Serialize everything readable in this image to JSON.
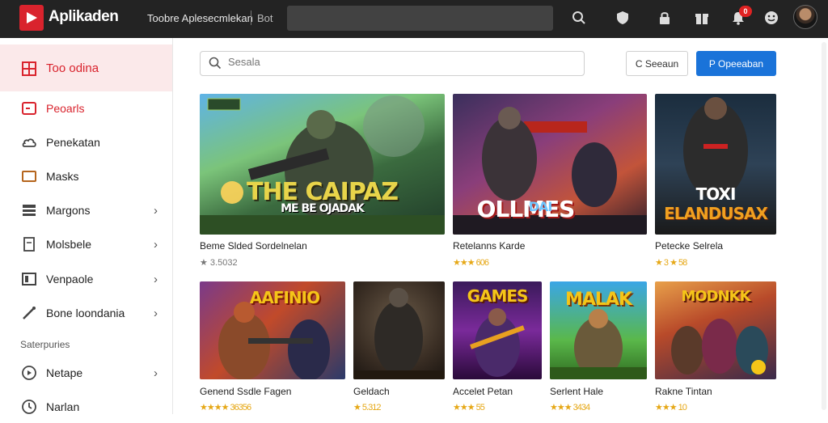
{
  "app": {
    "title": "Aplikaden"
  },
  "topbar": {
    "link": "Toobre Aplesecmlekan",
    "link2": "Bot"
  },
  "sidebar": {
    "items": [
      {
        "label": "Too odina",
        "icon": "grid-icon"
      },
      {
        "label": "Peoarls",
        "icon": "folder-icon"
      },
      {
        "label": "Penekatan",
        "icon": "cloud-icon"
      },
      {
        "label": "Masks",
        "icon": "box-icon"
      },
      {
        "label": "Margons",
        "icon": "layers-icon"
      },
      {
        "label": "Molsbele",
        "icon": "file-icon"
      },
      {
        "label": "Venpaole",
        "icon": "window-icon"
      },
      {
        "label": "Bone loondania",
        "icon": "brush-icon"
      }
    ],
    "section_label": "Saterpuries",
    "section_items": [
      {
        "label": "Netape",
        "icon": "compass-icon"
      },
      {
        "label": "Narlan",
        "icon": "clock-icon"
      }
    ]
  },
  "main": {
    "search_placeholder": "Sesala",
    "ghost_button": "C Seeaun",
    "primary_button": "P Opeeaban"
  },
  "games_row1": [
    {
      "title": "Beme Slded Sordelnelan",
      "rating": "★ 3.5032",
      "art_text": "THE CAIPAZ",
      "art_sub": "ME BE OJADAK"
    },
    {
      "title": "Retelanns Karde",
      "rating": "★★★ 606",
      "art_text": "OLLMES",
      "art_sub": "DAI"
    },
    {
      "title": "Petecke Selrela",
      "rating": "★ 3 ★ 58",
      "art_text": "TOXI",
      "art_sub": "ELANDUSAX"
    }
  ],
  "games_row2": [
    {
      "title": "Genend Ssdle Fagen",
      "rating": "★★★★ 36356",
      "art_text": "AAFINIO"
    },
    {
      "title": "Geldach",
      "rating": "★ 5.312",
      "art_text": ""
    },
    {
      "title": "Accelet Petan",
      "rating": "★★★ 55",
      "art_text": "GAMES"
    },
    {
      "title": "Serlent Hale",
      "rating": "★★★ 3434",
      "art_text": "MALAK"
    },
    {
      "title": "Rakne Tintan",
      "rating": "★★★ 10",
      "art_text": "MODNKK"
    }
  ],
  "colors": {
    "accent": "#d9232d",
    "primary": "#1a73d9",
    "topbar": "#232323"
  }
}
